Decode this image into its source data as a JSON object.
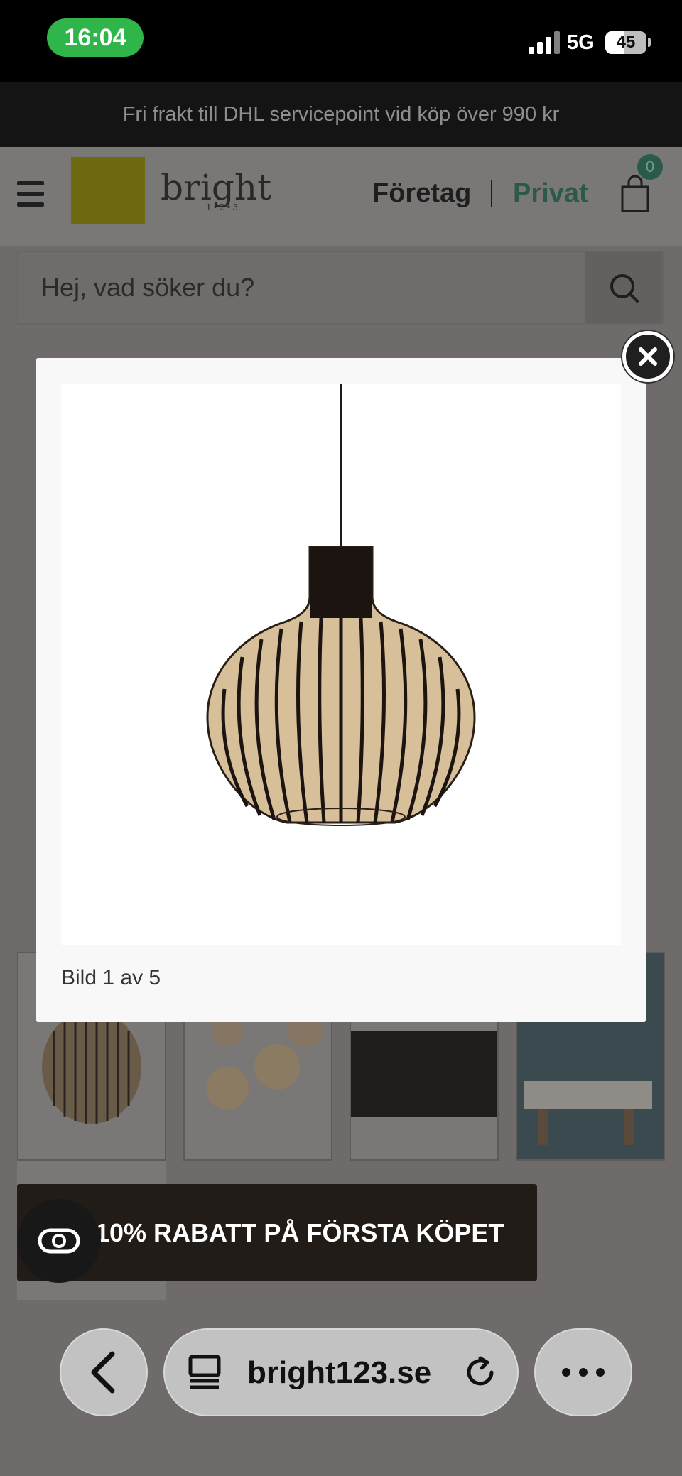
{
  "status_bar": {
    "time": "16:04",
    "network": "5G",
    "battery": "45",
    "battery_level": 0.45
  },
  "promo": {
    "text": "Fri frakt till DHL servicepoint vid köp över 990 kr"
  },
  "header": {
    "logo_text": "bright",
    "logo_sub": "1•2•3",
    "nav_business": "Företag",
    "nav_private": "Privat",
    "cart_count": "0"
  },
  "search": {
    "placeholder": "Hej, vad söker du?"
  },
  "modal": {
    "caption": "Bild 1 av 5"
  },
  "banner": {
    "discount_text": "10% RABATT PÅ FÖRSTA KÖPET"
  },
  "browser": {
    "url": "bright123.se"
  },
  "icons": [
    "hamburger-icon",
    "cart-icon",
    "search-icon",
    "close-icon",
    "chat-icon",
    "back-icon",
    "tabs-icon",
    "reload-icon",
    "more-icon"
  ]
}
